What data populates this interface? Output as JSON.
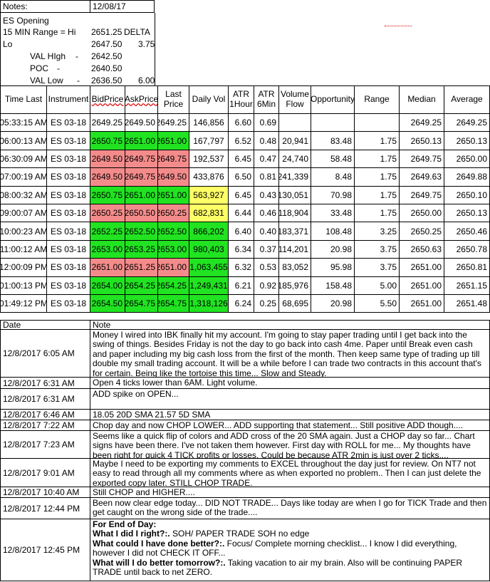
{
  "summary": {
    "notes_label": "Notes:",
    "notes_date": "12/08/17",
    "es_opening": "ES Opening",
    "range_label": "15 MIN Range = Hi",
    "range_hi": "2651.25",
    "delta_label": "DELTA",
    "lo_label": "Lo",
    "lo_value": "2647.50",
    "delta_value": "3.75",
    "val_high_label": "VAL HIgh",
    "val_high_dash": "-",
    "val_high": "2642.50",
    "poc_label": "POC",
    "poc_dash": "-",
    "poc": "2640.50",
    "val_low_label": "VAL Low",
    "val_low_dash": "-",
    "val_low": "2636.50",
    "val_low_extra": "6.00"
  },
  "table": {
    "headers": [
      "Time Last",
      "Instrument",
      "BidPrice",
      "AskPrice",
      "Last Price",
      "Daily Vol",
      "ATR 1Hour",
      "ATR 6Min",
      "Volume Flow",
      "Opportunity",
      "Range",
      "Median",
      "Average"
    ],
    "rows": [
      [
        "05:33:15 AM",
        "ES 03-18",
        "2649.25",
        "2649.50",
        "2649.25",
        "146,856",
        "6.60",
        "0.69",
        "",
        "",
        "",
        "2649.25",
        "2649.25"
      ],
      [
        "06:00:13 AM",
        "ES 03-18",
        "2650.75",
        "2651.00",
        "2651.00",
        "167,797",
        "6.52",
        "0.48",
        "20,941",
        "83.48",
        "1.75",
        "2650.13",
        "2650.13"
      ],
      [
        "06:30:09 AM",
        "ES 03-18",
        "2649.50",
        "2649.75",
        "2649.75",
        "192,537",
        "6.45",
        "0.47",
        "24,740",
        "58.48",
        "1.75",
        "2649.75",
        "2650.00"
      ],
      [
        "07:00:19 AM",
        "ES 03-18",
        "2649.50",
        "2649.75",
        "2649.50",
        "433,876",
        "6.50",
        "0.81",
        "241,339",
        "8.48",
        "1.75",
        "2649.63",
        "2649.88"
      ],
      [
        "08:00:32 AM",
        "ES 03-18",
        "2650.75",
        "2651.00",
        "2651.00",
        "563,927",
        "6.45",
        "0.43",
        "130,051",
        "70.98",
        "1.75",
        "2649.75",
        "2650.10"
      ],
      [
        "09:00:07 AM",
        "ES 03-18",
        "2650.25",
        "2650.50",
        "2650.25",
        "682,831",
        "6.44",
        "0.46",
        "118,904",
        "33.48",
        "1.75",
        "2650.00",
        "2650.13"
      ],
      [
        "10:00:23 AM",
        "ES 03-18",
        "2652.25",
        "2652.50",
        "2652.50",
        "866,202",
        "6.40",
        "0.40",
        "183,371",
        "108.48",
        "3.25",
        "2650.25",
        "2650.46"
      ],
      [
        "11:00:12 AM",
        "ES 03-18",
        "2653.00",
        "2653.25",
        "2653.00",
        "980,403",
        "6.34",
        "0.37",
        "114,201",
        "20.98",
        "3.75",
        "2650.63",
        "2650.78"
      ],
      [
        "12:00:09 PM",
        "ES 03-18",
        "2651.00",
        "2651.25",
        "2651.00",
        "1,063,455",
        "6.32",
        "0.53",
        "83,052",
        "95.98",
        "3.75",
        "2651.00",
        "2650.81"
      ],
      [
        "01:00:13 PM",
        "ES 03-18",
        "2654.00",
        "2654.25",
        "2654.25",
        "1,249,431",
        "6.21",
        "0.92",
        "185,976",
        "158.48",
        "5.00",
        "2651.00",
        "2651.15"
      ],
      [
        "01:49:12 PM",
        "ES 03-18",
        "2654.50",
        "2654.75",
        "2654.75",
        "1,318,126",
        "6.24",
        "0.25",
        "68,695",
        "20.98",
        "5.50",
        "2651.00",
        "2651.48"
      ]
    ],
    "row_colors": [
      "none",
      "green",
      "red",
      "red",
      "green",
      "red",
      "green",
      "green",
      "red",
      "green",
      "green"
    ],
    "last_colors": [
      "none",
      "green",
      "red",
      "red",
      "green",
      "red",
      "green",
      "green",
      "red",
      "green",
      "green"
    ],
    "vol_colors": [
      "none",
      "none",
      "none",
      "none",
      "yellow",
      "yellow",
      "green",
      "green",
      "green",
      "green",
      "green"
    ],
    "colors": {
      "green": "#21e321",
      "red": "#f48b8b",
      "yellow": "#ffff66"
    }
  },
  "notes": {
    "date_header": "Date",
    "note_header": "Note",
    "entries": [
      {
        "date": "12/8/2017 6:05 AM",
        "note": "Money I wired into IBK finally hit my account.  I'm going to stay paper trading until I get back into the swing of things.  Besides Friday is not the day to go back into cash 4me.  Paper until Break even cash and paper including my big cash loss from the first of the month.  Then keep same type of trading up till double my small trading account.  It will be a while before I can trade two contracts in this account that's for certain.  Being like the tortoise this time... Slow and Steady."
      },
      {
        "date": "12/8/2017 6:31 AM",
        "note": "Open 4 ticks lower than 6AM.  Light volume."
      },
      {
        "date": "12/8/2017 6:31 AM",
        "note": "ADD spike on OPEN..."
      },
      {
        "date": "12/8/2017 6:46 AM",
        "note": "18.05 20D SMA 21.57 5D SMA"
      },
      {
        "date": "12/8/2017 7:22 AM",
        "note": "Chop day and now CHOP LOWER... ADD supporting that statement... Still positive ADD though...."
      },
      {
        "date": "12/8/2017 7:23 AM",
        "note": "Seems like a quick flip of colors and ADD cross of the 20 SMA again.  Just a CHOP day so far... Chart signs have been there.  I've not taken them however.  First day with ROLL for me... My thoughts have been right for quick 4 TICK profits or losses.  Could be because ATR 2min is just over 2 ticks...."
      },
      {
        "date": "12/8/2017 9:01 AM",
        "note": "Maybe I need to be exporting my comments to EXCEL throughout the day just for review.  On NT7 not easy to read through all my comments where as when exported no problem.. Then I can just delete the exported copy later.  STILL CHOP TRADE."
      },
      {
        "date": "12/8/2017 10:40 AM",
        "note": "Still CHOP and HIGHER...."
      },
      {
        "date": "12/8/2017 12:44 PM",
        "note": "Been now clear edge today...   DID NOT TRADE... Days like today are when I go for TICK Trade and then get caught on the wrong side of the trade...."
      }
    ],
    "final": {
      "date": "12/8/2017 12:45 PM",
      "title": "For End of Day:",
      "q1": "What I did I right?:.",
      "a1": " SOH/ PAPER TRADE SOH no edge",
      "q2": "What could I have done better?:.",
      "a2": " Focus/ Complete morning checklist... I know I did everything, however I did not CHECK IT OFF...",
      "q3": "What will I do better tomorrow?:.",
      "a3": "  Taking vacation to air my brain.  Also will be continuing PAPER TRADE until back to net ZERO."
    }
  }
}
